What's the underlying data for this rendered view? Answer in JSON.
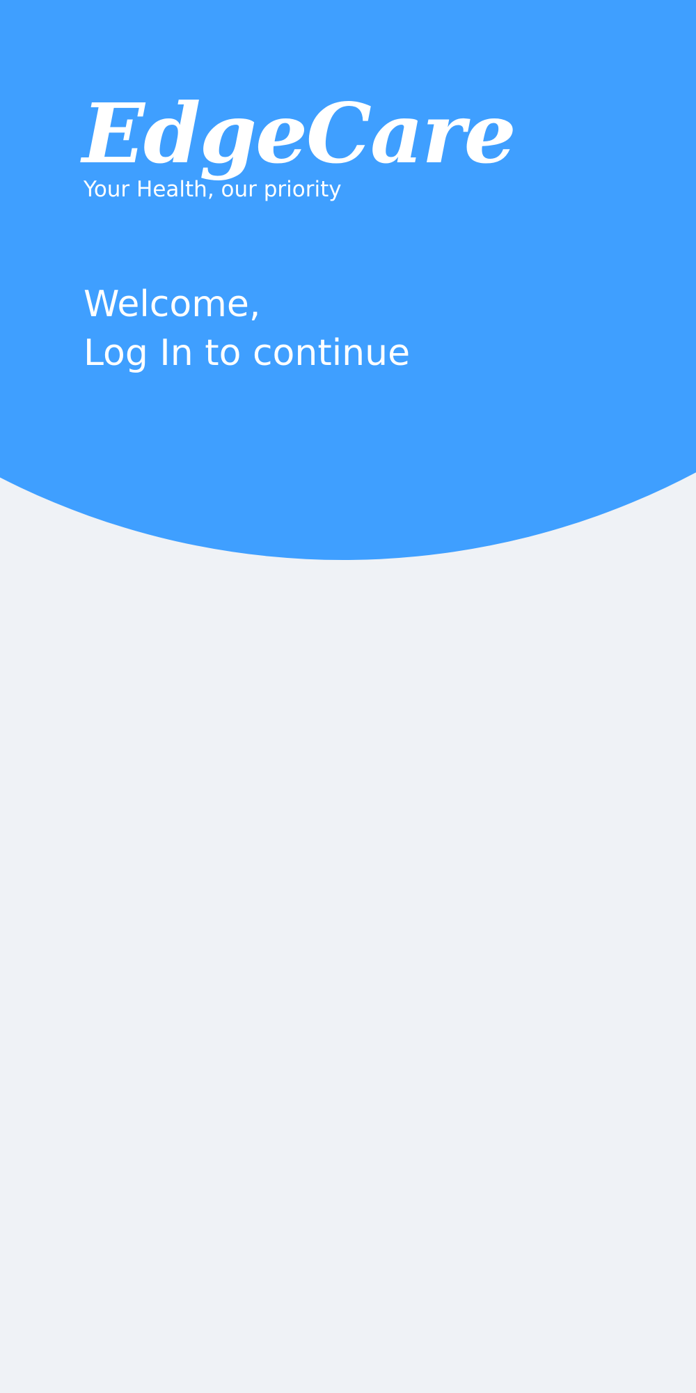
{
  "brand": {
    "name": "EdgeCare",
    "tagline": "Your Health, our priority"
  },
  "welcome": {
    "greeting": "Welcome,",
    "prompt": "Log In to continue"
  },
  "colors": {
    "primary": "#3f9fff",
    "background": "#eff2f6",
    "text_on_primary": "#ffffff"
  }
}
